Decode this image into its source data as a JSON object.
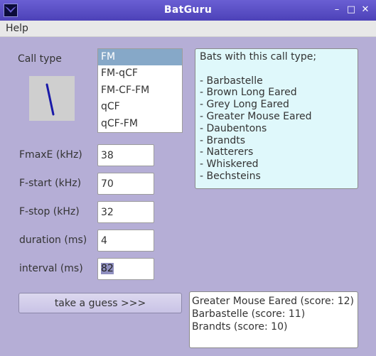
{
  "window": {
    "title": "BatGuru",
    "controls": {
      "minimize": "–",
      "maximize": "□",
      "close": "✕"
    }
  },
  "menu": {
    "help": "Help"
  },
  "form": {
    "call_type_label": "Call type",
    "call_types": [
      "FM",
      "FM-qCF",
      "FM-CF-FM",
      "qCF",
      "qCF-FM"
    ],
    "selected_call_type": "FM",
    "fields": [
      {
        "label": "FmaxE (kHz)",
        "value": "38"
      },
      {
        "label": "F-start (kHz)",
        "value": "70"
      },
      {
        "label": "F-stop (kHz)",
        "value": "32"
      },
      {
        "label": "duration (ms)",
        "value": "4"
      },
      {
        "label": "interval (ms)",
        "value": "82"
      }
    ]
  },
  "bats_panel": {
    "heading": "Bats with this call type;",
    "bats": [
      "- Barbastelle",
      "- Brown Long Eared",
      "- Grey Long Eared",
      "- Greater Mouse Eared",
      "- Daubentons",
      "- Brandts",
      "- Natterers",
      "- Whiskered",
      "- Bechsteins"
    ]
  },
  "guess_button_label": "take a guess >>>",
  "results": [
    "Greater Mouse Eared (score: 12)",
    "Barbastelle (score: 11)",
    "Brandts (score: 10)"
  ],
  "colors": {
    "background": "#b5aed6",
    "titlebar": "#5a4fc6",
    "selection": "#86a8c8",
    "call_trace": "#1a1aa8",
    "bats_panel_bg": "#dff8fb"
  }
}
